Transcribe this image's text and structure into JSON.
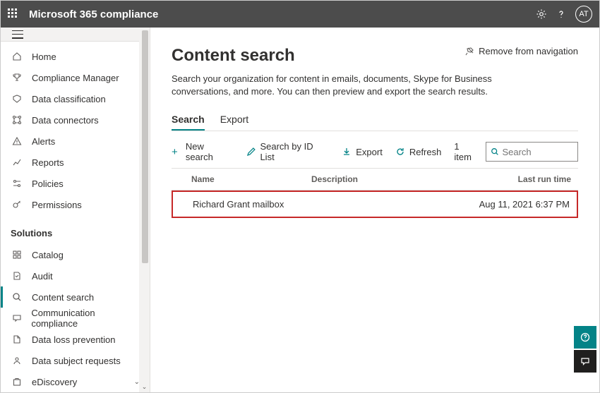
{
  "suite": {
    "title": "Microsoft 365 compliance",
    "avatar": "AT"
  },
  "sidebar": {
    "items": [
      {
        "label": "Home",
        "icon": "home-icon"
      },
      {
        "label": "Compliance Manager",
        "icon": "trophy-icon"
      },
      {
        "label": "Data classification",
        "icon": "tag-icon"
      },
      {
        "label": "Data connectors",
        "icon": "connectors-icon"
      },
      {
        "label": "Alerts",
        "icon": "alert-icon"
      },
      {
        "label": "Reports",
        "icon": "reports-icon"
      },
      {
        "label": "Policies",
        "icon": "policies-icon"
      },
      {
        "label": "Permissions",
        "icon": "permissions-icon"
      }
    ],
    "solutionsHeader": "Solutions",
    "solutions": [
      {
        "label": "Catalog",
        "icon": "catalog-icon"
      },
      {
        "label": "Audit",
        "icon": "audit-icon"
      },
      {
        "label": "Content search",
        "icon": "search-icon",
        "active": true
      },
      {
        "label": "Communication compliance",
        "icon": "comm-icon"
      },
      {
        "label": "Data loss prevention",
        "icon": "dlp-icon"
      },
      {
        "label": "Data subject requests",
        "icon": "dsr-icon"
      },
      {
        "label": "eDiscovery",
        "icon": "ediscovery-icon",
        "expandable": true
      }
    ]
  },
  "page": {
    "title": "Content search",
    "removeLabel": "Remove from navigation",
    "description": "Search your organization for content in emails, documents, Skype for Business conversations, and more. You can then preview and export the search results."
  },
  "tabs": {
    "search": "Search",
    "export": "Export"
  },
  "toolbar": {
    "newSearch": "New search",
    "searchById": "Search by ID List",
    "export": "Export",
    "refresh": "Refresh",
    "count": "1 item",
    "searchPlaceholder": "Search"
  },
  "table": {
    "headers": {
      "name": "Name",
      "description": "Description",
      "lastRun": "Last run time"
    },
    "rows": [
      {
        "name": "Richard Grant mailbox",
        "description": "",
        "lastRun": "Aug 11, 2021 6:37 PM"
      }
    ]
  }
}
